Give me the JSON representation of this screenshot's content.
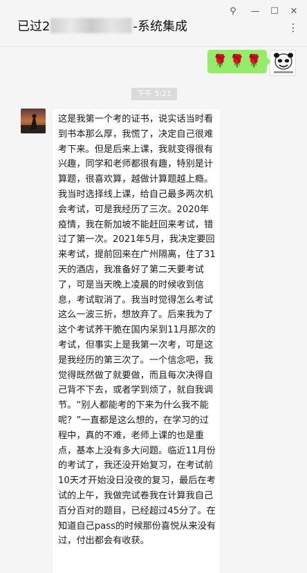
{
  "window": {
    "title_prefix": "已过2",
    "title_suffix": "-系统集成",
    "controls": {
      "pin": "⚲",
      "minimize": "—",
      "maximize": "☐",
      "close": "✕",
      "more": "⋮"
    }
  },
  "outgoing": {
    "emojis": [
      "🌹",
      "🌹",
      "🌹"
    ],
    "avatar_caption": "表情包"
  },
  "timestamp": "下午 5:21",
  "incoming": {
    "text": "这是我第一个考的证书，说实话当时看到书本那么厚，我慌了，决定自己很难考下来。但是后来上课，我就变得很有兴趣，同学和老师都很有趣，特别是计算题，很喜欢算，越做计算题越上瘾。我当时选择线上课，给自己最多两次机会考试，可是我经历了三次。2020年疫情，我在新加坡不能赶回来考试，错过了第一次。2021年5月，我决定要回来考试，提前回来在广州隔离，住了31天的酒店，我准备好了第二天要考试了，可是当天晚上凌晨的时候收到信息，考试取消了。我当时觉得怎么考试这么一波三折，想放弃了。后来我为了这个考试荞干脆在国内呆到11月那次的考试，但事实上是我第一次考，可是这是我经历的第三次了。一个信念吧，我觉得既然做了就要做，而且每次决得自己背不下去，或者学到烦了，就自我调节。“别人都能考的下来为什么我不能呢？”一直都是这么想的，在学习的过程中，真的不难，老师上课的也是重点，基本上没有多大问题。临近11月份的考试了，我还没开始复习，在考试前10天才开始没日没夜的复习，最后在考试的上午，我做完试卷我在计算我自己百分百对的题目，已经超过45分了。在知道自己pass的时候那份喜悦从来没有过，付出都会有收获。"
  }
}
